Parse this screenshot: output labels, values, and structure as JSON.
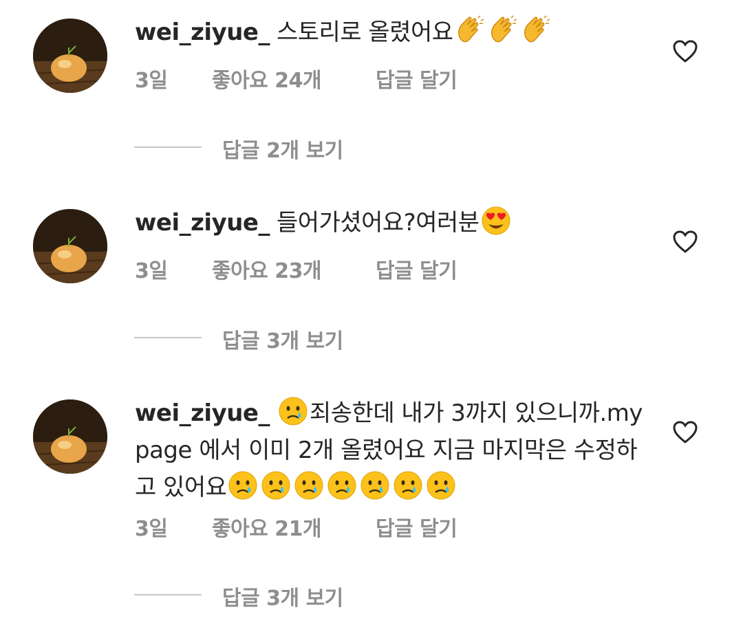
{
  "comments": [
    {
      "username": "wei_ziyue_",
      "text_before": "스토리로 올렸어요",
      "emojis_after": [
        "clapping-hands",
        "clapping-hands",
        "clapping-hands"
      ],
      "time": "3일",
      "likes": "좋아요 24개",
      "reply": "답글 달기",
      "view_replies": "답글 2개 보기"
    },
    {
      "username": "wei_ziyue_",
      "text_before": "들어가셨어요?여러분",
      "emojis_after": [
        "heart-eyes"
      ],
      "time": "3일",
      "likes": "좋아요 23개",
      "reply": "답글 달기",
      "view_replies": "답글 3개 보기"
    },
    {
      "username": "wei_ziyue_",
      "emoji_before": "crying-face",
      "text_before": "죄송한데 내가 3까지 있으니까.my page 에서 이미 2개 올렸어요 지금 마지막은 수정하고 있어요",
      "emojis_after": [
        "crying-face",
        "crying-face",
        "crying-face",
        "crying-face",
        "crying-face",
        "crying-face",
        "crying-face"
      ],
      "time": "3일",
      "likes": "좋아요 21개",
      "reply": "답글 달기",
      "view_replies": "답글 3개 보기"
    }
  ],
  "colors": {
    "text": "#262626",
    "secondary": "#8e8e8e",
    "divider": "#c7c7c7"
  }
}
